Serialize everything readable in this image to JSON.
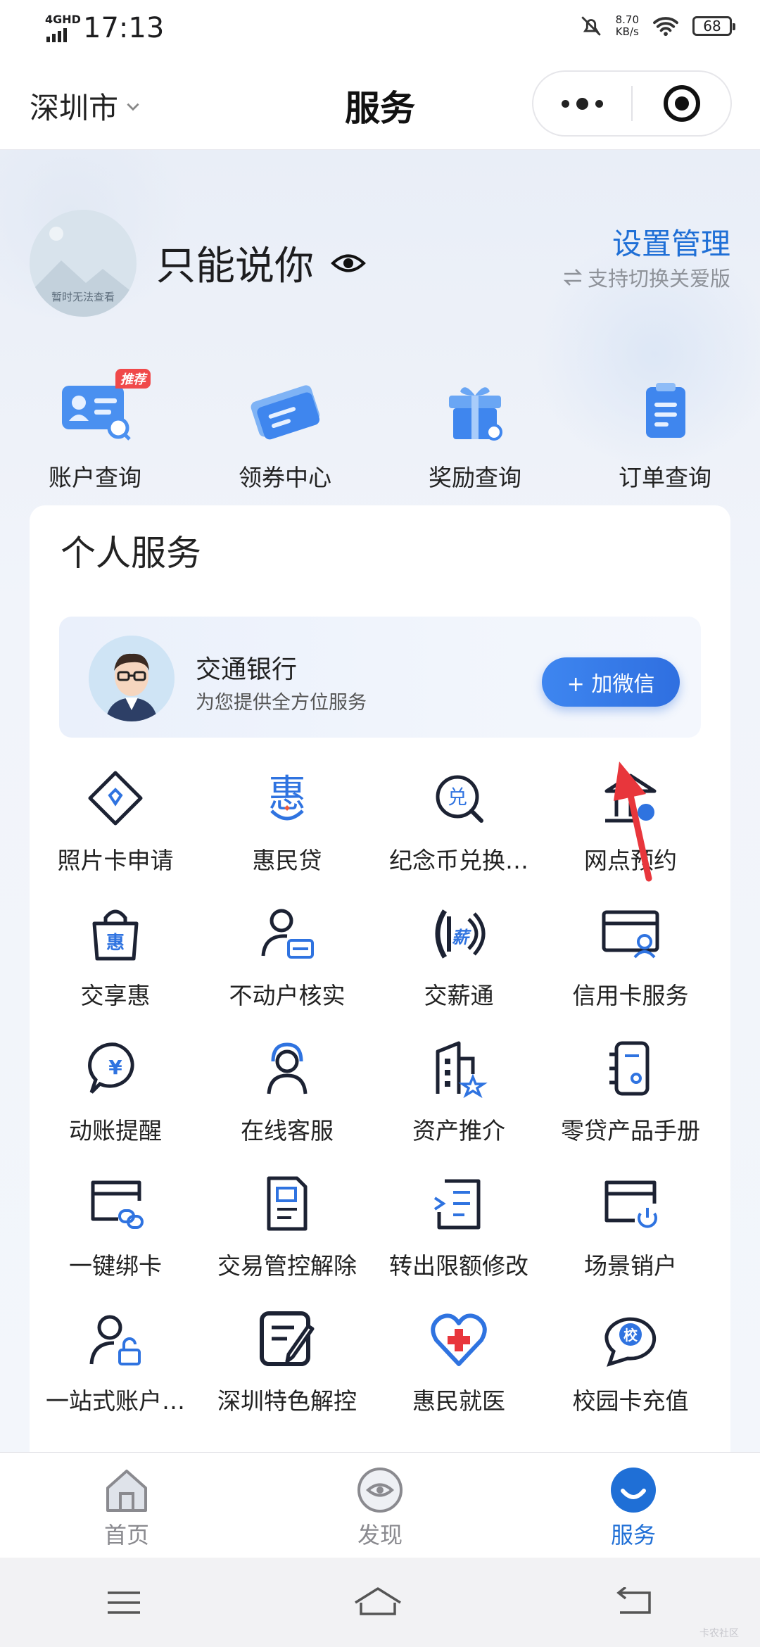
{
  "status_bar": {
    "network": "4GHD",
    "time": "17:13",
    "speed_value": "8.70",
    "speed_unit": "KB/s",
    "battery": "68"
  },
  "nav": {
    "city": "深圳市",
    "title": "服务"
  },
  "profile": {
    "avatar_text": "暂时无法查看",
    "username": "只能说你",
    "settings_label": "设置管理",
    "care_mode_label": "支持切换关爱版"
  },
  "quick_actions": [
    {
      "label": "账户查询",
      "icon": "account-card-icon",
      "badge": "推荐"
    },
    {
      "label": "领券中心",
      "icon": "coupon-icon"
    },
    {
      "label": "奖励查询",
      "icon": "gift-box-icon"
    },
    {
      "label": "订单查询",
      "icon": "clipboard-icon"
    }
  ],
  "personal_service": {
    "title": "个人服务",
    "banner": {
      "title": "交通银行",
      "subtitle": "为您提供全方位服务",
      "button": "+ 加微信"
    },
    "items": [
      {
        "label": "照片卡申请",
        "icon": "diamond-card-icon"
      },
      {
        "label": "惠民贷",
        "icon": "hui-loan-icon"
      },
      {
        "label": "纪念币兑换…",
        "icon": "coin-exchange-icon"
      },
      {
        "label": "网点预约",
        "icon": "branch-icon"
      },
      {
        "label": "交享惠",
        "icon": "shopping-bag-icon"
      },
      {
        "label": "不动户核实",
        "icon": "user-card-icon"
      },
      {
        "label": "交薪通",
        "icon": "salary-icon"
      },
      {
        "label": "信用卡服务",
        "icon": "credit-card-icon"
      },
      {
        "label": "动账提醒",
        "icon": "yen-chat-icon"
      },
      {
        "label": "在线客服",
        "icon": "headset-icon"
      },
      {
        "label": "资产推介",
        "icon": "building-star-icon"
      },
      {
        "label": "零贷产品手册",
        "icon": "notebook-icon"
      },
      {
        "label": "一键绑卡",
        "icon": "card-link-icon"
      },
      {
        "label": "交易管控解除",
        "icon": "document-icon"
      },
      {
        "label": "转出限额修改",
        "icon": "list-edit-icon"
      },
      {
        "label": "场景销户",
        "icon": "card-power-icon"
      },
      {
        "label": "一站式账户…",
        "icon": "user-lock-icon"
      },
      {
        "label": "深圳特色解控",
        "icon": "edit-pen-icon"
      },
      {
        "label": "惠民就医",
        "icon": "medical-heart-icon"
      },
      {
        "label": "校园卡充值",
        "icon": "campus-chat-icon"
      }
    ]
  },
  "tab_bar": [
    {
      "label": "首页",
      "icon": "home-icon",
      "active": false
    },
    {
      "label": "发现",
      "icon": "discover-icon",
      "active": false
    },
    {
      "label": "服务",
      "icon": "service-smile-icon",
      "active": true
    }
  ],
  "system_nav": [
    {
      "icon": "menu-icon"
    },
    {
      "icon": "home-outline-icon"
    },
    {
      "icon": "back-icon"
    }
  ],
  "watermark": "卡农社区",
  "colors": {
    "accent": "#1f6fd6",
    "annotation_arrow": "#e8363c"
  }
}
